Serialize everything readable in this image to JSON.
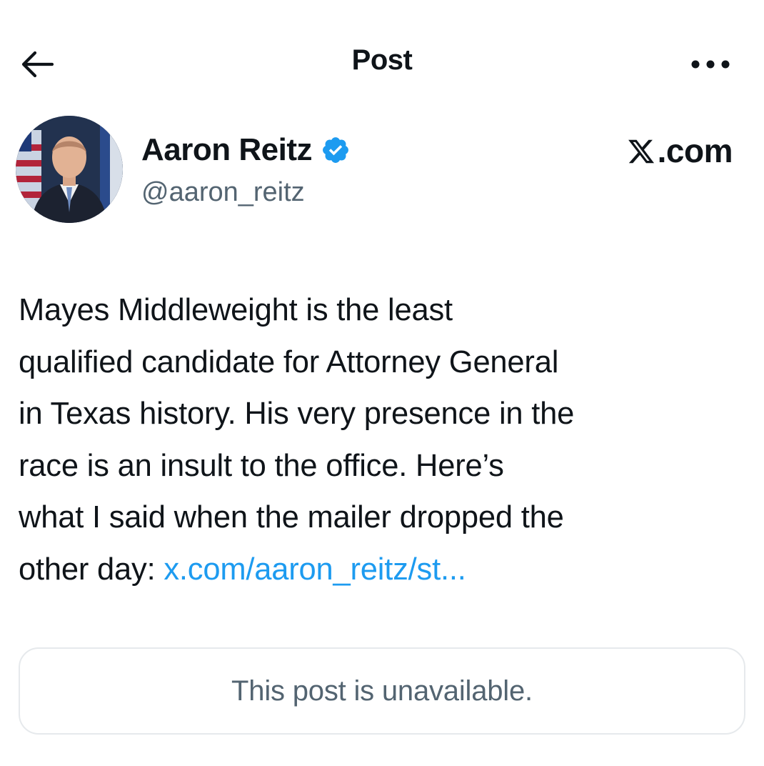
{
  "header": {
    "title": "Post",
    "back_icon": "arrow-left-icon",
    "more_icon": "more-horizontal-icon"
  },
  "author": {
    "name": "Aaron Reitz",
    "handle": "@aaron_reitz",
    "verified_icon": "verified-badge-icon",
    "avatar_icon": "profile-photo"
  },
  "brand": {
    "text": ".com",
    "logo_icon": "x-logo-icon"
  },
  "post": {
    "lines": [
      "Mayes Middleweight is the least",
      "qualified candidate for Attorney General",
      "in Texas history. His very presence in the",
      "race is an insult to the office. Here’s",
      "what I said when the mailer dropped the",
      "other day: "
    ],
    "link_text": "x.com/aaron_reitz/st..."
  },
  "quoted_post": {
    "text": "This post is unavailable."
  },
  "colors": {
    "text": "#0f1419",
    "secondary": "#536471",
    "link": "#1d9bf0",
    "verified": "#1d9bf0",
    "border": "#e6e9ec"
  }
}
